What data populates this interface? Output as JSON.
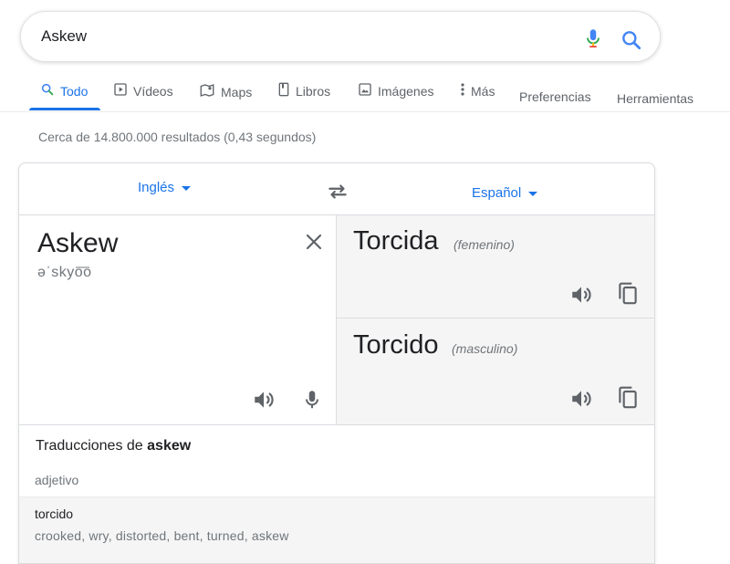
{
  "search": {
    "query": "Askew"
  },
  "tabs": [
    {
      "label": "Todo",
      "icon": "search-icon",
      "active": true
    },
    {
      "label": "Vídeos",
      "icon": "play-icon"
    },
    {
      "label": "Maps",
      "icon": "map-icon"
    },
    {
      "label": "Libros",
      "icon": "book-icon"
    },
    {
      "label": "Imágenes",
      "icon": "image-icon"
    },
    {
      "label": "Más",
      "icon": "more-vert-icon"
    },
    {
      "label": "Preferencias"
    },
    {
      "label": "Herramientas"
    }
  ],
  "result_stats": "Cerca de 14.800.000 resultados (0,43 segundos)",
  "translator": {
    "source_lang": "Inglés",
    "target_lang": "Español",
    "source_text": "Askew",
    "phonetic": "əˈskyo͞o",
    "translations": [
      {
        "word": "Torcida",
        "gender": "(femenino)"
      },
      {
        "word": "Torcido",
        "gender": "(masculino)"
      }
    ]
  },
  "dictionary": {
    "title_prefix": "Traducciones de ",
    "title_word": "askew",
    "part_of_speech": "adjetivo",
    "entries": [
      {
        "word": "torcido",
        "synonyms": "crooked, wry, distorted, bent, turned, askew"
      }
    ]
  },
  "colors": {
    "accent": "#1a73e8",
    "muted": "#5f6368",
    "pane_bg": "#f5f5f5"
  }
}
